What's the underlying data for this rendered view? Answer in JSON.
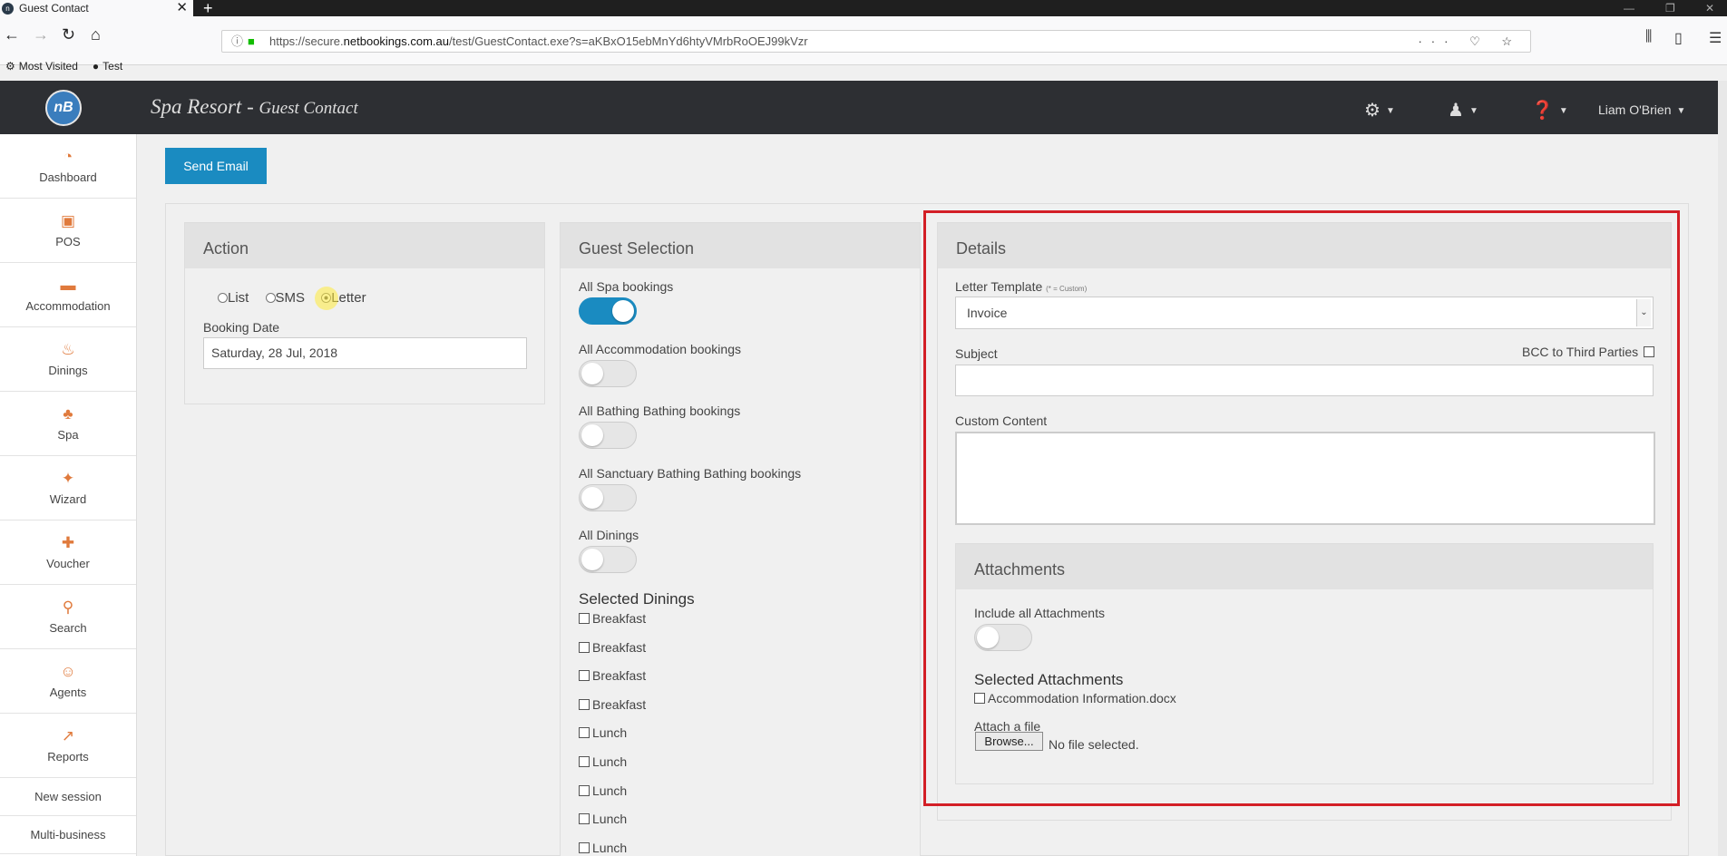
{
  "browser": {
    "tab_title": "Guest Contact",
    "tab_close": "✕",
    "new_tab": "+",
    "url_prefix": "https://secure.",
    "url_domain": "netbookings.com.au",
    "url_path": "/test/GuestContact.exe?s=aKBxO15ebMnYd6htyVMrbRoOEJ99kVzr",
    "url_actions": "··· ♡ ☆",
    "bookmarks": [
      {
        "icon": "gear-icon",
        "glyph": "⚙",
        "label": "Most Visited"
      },
      {
        "icon": "nb-favicon",
        "glyph": "●",
        "label": "Test"
      }
    ]
  },
  "app": {
    "logo_text": "nB",
    "title": "Spa Resort",
    "separator": " - ",
    "subtitle": "Guest Contact",
    "user_name": "Liam O'Brien"
  },
  "sidebar": {
    "items": [
      {
        "label": "Dashboard",
        "icon": "dashboard-icon",
        "glyph": "◔"
      },
      {
        "label": "POS",
        "icon": "pos-icon",
        "glyph": "▣"
      },
      {
        "label": "Accommodation",
        "icon": "bed-icon",
        "glyph": "▬"
      },
      {
        "label": "Dinings",
        "icon": "dining-icon",
        "glyph": "♨"
      },
      {
        "label": "Spa",
        "icon": "spa-icon",
        "glyph": "♣"
      },
      {
        "label": "Wizard",
        "icon": "wand-icon",
        "glyph": "✦"
      },
      {
        "label": "Voucher",
        "icon": "gift-icon",
        "glyph": "✚"
      },
      {
        "label": "Search",
        "icon": "search-icon",
        "glyph": "⚲"
      },
      {
        "label": "Agents",
        "icon": "agent-icon",
        "glyph": "☺"
      },
      {
        "label": "Reports",
        "icon": "chart-icon",
        "glyph": "↗"
      }
    ],
    "links": [
      "New session",
      "Multi-business"
    ]
  },
  "toolbar": {
    "send_email": "Send Email"
  },
  "action": {
    "heading": "Action",
    "options": [
      "List",
      "SMS",
      "Letter"
    ],
    "selected": "Letter",
    "booking_date_label": "Booking Date",
    "booking_date_value": "Saturday, 28 Jul, 2018"
  },
  "guest_selection": {
    "heading": "Guest Selection",
    "toggles": [
      {
        "label": "All Spa bookings",
        "on": true
      },
      {
        "label": "All Accommodation bookings",
        "on": false
      },
      {
        "label": "All Bathing Bathing bookings",
        "on": false
      },
      {
        "label": "All Sanctuary Bathing Bathing bookings",
        "on": false
      },
      {
        "label": "All Dinings",
        "on": false
      }
    ],
    "selected_dinings_heading": "Selected Dinings",
    "dinings": [
      "Breakfast",
      "Breakfast",
      "Breakfast",
      "Breakfast",
      "Lunch",
      "Lunch",
      "Lunch",
      "Lunch",
      "Lunch"
    ]
  },
  "details": {
    "heading": "Details",
    "template_label": "Letter Template",
    "template_note": "(* = Custom)",
    "template_value": "Invoice",
    "subject_label": "Subject",
    "subject_value": "",
    "bcc_label": "BCC to Third Parties",
    "custom_content_label": "Custom Content",
    "custom_content_value": "",
    "attachments": {
      "heading": "Attachments",
      "include_all_label": "Include all Attachments",
      "include_all_on": false,
      "selected_heading": "Selected Attachments",
      "files": [
        "Accommodation Information.docx"
      ],
      "attach_label": "Attach a file",
      "browse_label": "Browse...",
      "no_file_text": "No file selected."
    }
  }
}
